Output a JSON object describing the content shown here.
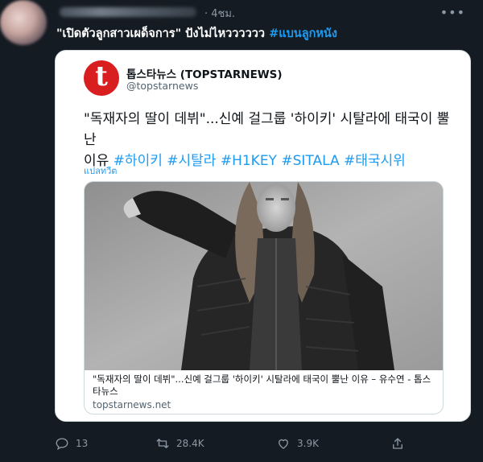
{
  "tweet": {
    "time": "· 4ชม.",
    "text_plain": "\"เปิดตัวลูกสาวเผด็จการ\" ปังไม่ไหวววววว",
    "hashtag": "#แบนลูกหนัง",
    "replies": "13",
    "retweets": "28.4K",
    "likes": "3.9K"
  },
  "quoted": {
    "logo_letter": "t",
    "source_name": "톱스타뉴스 (TOPSTARNEWS)",
    "source_handle": "@topstarnews",
    "headline_line1": "\"독재자의 딸이 데뷔\"...신예 걸그룹 '하이키' 시탈라에 태국이 뿔난",
    "headline_line2_plain": "이유 ",
    "headline_hashtags": "#하이키 #시탈라 #H1KEY #SITALA #태국시위",
    "translate": "แปลทวีต",
    "link_title": "\"독재자의 딸이 데뷔\"...신예 걸그룹 '하이키' 시탈라에 태국이 뿔난 이유 – 유수연 - 톱스타뉴스",
    "link_domain": "topstarnews.net"
  },
  "colors": {
    "background": "#151b22",
    "link": "#1d9bf0",
    "logo": "#d81e1e"
  }
}
